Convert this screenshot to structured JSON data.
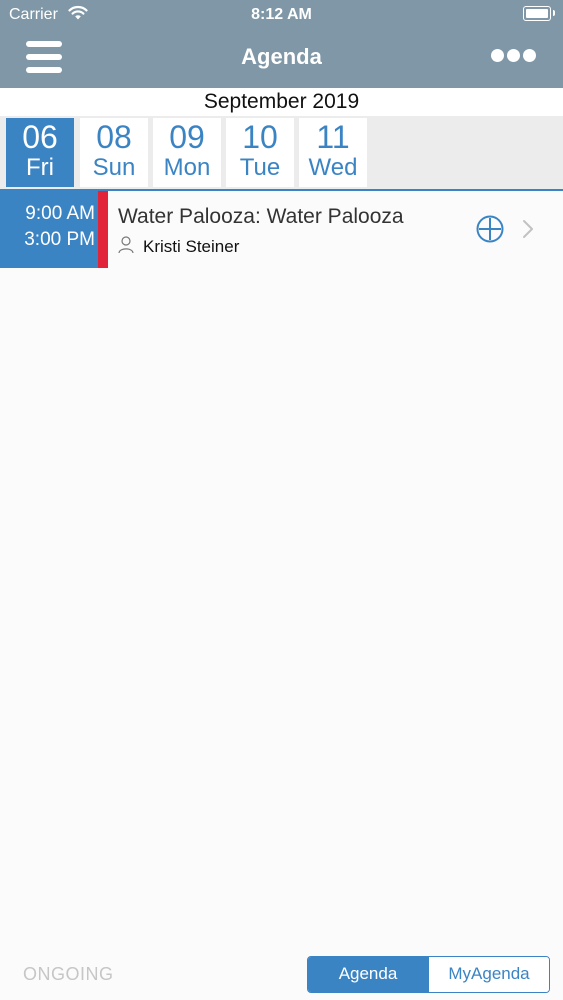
{
  "status_bar": {
    "carrier": "Carrier",
    "time": "8:12 AM",
    "wifi_icon": "wifi-icon",
    "battery_icon": "battery-icon"
  },
  "nav": {
    "menu_icon": "hamburger-menu-icon",
    "title": "Agenda",
    "more_icon": "more-dots-icon"
  },
  "calendar": {
    "month_label": "September 2019",
    "days": [
      {
        "num": "06",
        "name": "Fri",
        "selected": true
      },
      {
        "num": "08",
        "name": "Sun",
        "selected": false
      },
      {
        "num": "09",
        "name": "Mon",
        "selected": false
      },
      {
        "num": "10",
        "name": "Tue",
        "selected": false
      },
      {
        "num": "11",
        "name": "Wed",
        "selected": false
      }
    ]
  },
  "events": [
    {
      "start": "9:00 AM",
      "end": "3:00 PM",
      "title": "Water Palooza: Water Palooza",
      "person": "Kristi Steiner",
      "color": "#e1243a"
    }
  ],
  "footer": {
    "ongoing_label": "ONGOING",
    "segments": [
      {
        "label": "Agenda",
        "active": true
      },
      {
        "label": "MyAgenda",
        "active": false
      }
    ]
  },
  "colors": {
    "header_bg": "#7f97a6",
    "accent": "#3b84c4",
    "event_marker": "#e1243a"
  }
}
